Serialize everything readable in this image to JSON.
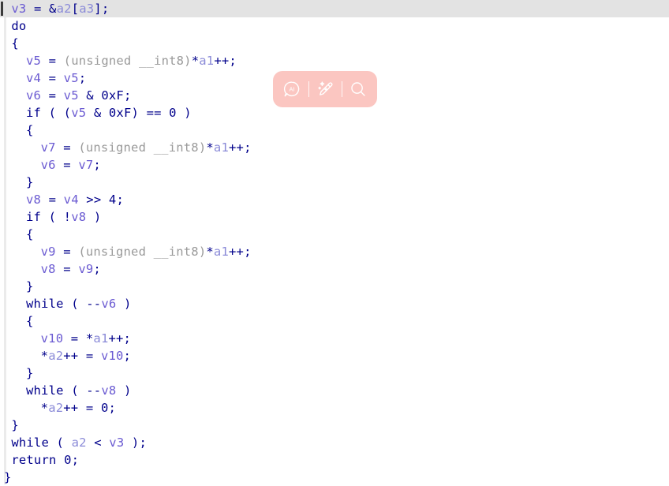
{
  "editor": {
    "language": "c-pseudocode",
    "current_line_index": 0,
    "colors": {
      "background": "#ffffff",
      "current_line_highlight": "#e3e3e3",
      "caret": "#3a3a3a",
      "gutter_rule": "#ebebeb",
      "keyword": "#00008b",
      "punctuation": "#00008b",
      "number": "#00008b",
      "local_variable": "#6b5bd2",
      "argument": "#8b8bd8",
      "type_cast": "#9a9a9a"
    },
    "lines": [
      {
        "indent": 1,
        "current": true,
        "tokens": [
          {
            "t": "v3",
            "c": "local"
          },
          {
            "t": " ",
            "c": "punc"
          },
          {
            "t": "=",
            "c": "punc"
          },
          {
            "t": " ",
            "c": "punc"
          },
          {
            "t": "&",
            "c": "punc"
          },
          {
            "t": "a2",
            "c": "arg"
          },
          {
            "t": "[",
            "c": "punc"
          },
          {
            "t": "a3",
            "c": "arg"
          },
          {
            "t": "]",
            "c": "punc"
          },
          {
            "t": ";",
            "c": "punc"
          }
        ]
      },
      {
        "indent": 1,
        "current": false,
        "tokens": [
          {
            "t": "do",
            "c": "kw"
          }
        ]
      },
      {
        "indent": 1,
        "current": false,
        "tokens": [
          {
            "t": "{",
            "c": "punc"
          }
        ]
      },
      {
        "indent": 3,
        "current": false,
        "tokens": [
          {
            "t": "v5",
            "c": "local"
          },
          {
            "t": " = ",
            "c": "punc"
          },
          {
            "t": "(unsigned __int8)",
            "c": "type"
          },
          {
            "t": "*",
            "c": "punc"
          },
          {
            "t": "a1",
            "c": "arg"
          },
          {
            "t": "++;",
            "c": "punc"
          }
        ]
      },
      {
        "indent": 3,
        "current": false,
        "tokens": [
          {
            "t": "v4",
            "c": "local"
          },
          {
            "t": " = ",
            "c": "punc"
          },
          {
            "t": "v5",
            "c": "local"
          },
          {
            "t": ";",
            "c": "punc"
          }
        ]
      },
      {
        "indent": 3,
        "current": false,
        "tokens": [
          {
            "t": "v6",
            "c": "local"
          },
          {
            "t": " = ",
            "c": "punc"
          },
          {
            "t": "v5",
            "c": "local"
          },
          {
            "t": " & ",
            "c": "punc"
          },
          {
            "t": "0xF",
            "c": "num"
          },
          {
            "t": ";",
            "c": "punc"
          }
        ]
      },
      {
        "indent": 3,
        "current": false,
        "tokens": [
          {
            "t": "if",
            "c": "kw"
          },
          {
            "t": " ( (",
            "c": "punc"
          },
          {
            "t": "v5",
            "c": "local"
          },
          {
            "t": " & ",
            "c": "punc"
          },
          {
            "t": "0xF",
            "c": "num"
          },
          {
            "t": ") == ",
            "c": "punc"
          },
          {
            "t": "0",
            "c": "num"
          },
          {
            "t": " )",
            "c": "punc"
          }
        ]
      },
      {
        "indent": 3,
        "current": false,
        "tokens": [
          {
            "t": "{",
            "c": "punc"
          }
        ]
      },
      {
        "indent": 5,
        "current": false,
        "tokens": [
          {
            "t": "v7",
            "c": "local"
          },
          {
            "t": " = ",
            "c": "punc"
          },
          {
            "t": "(unsigned __int8)",
            "c": "type"
          },
          {
            "t": "*",
            "c": "punc"
          },
          {
            "t": "a1",
            "c": "arg"
          },
          {
            "t": "++;",
            "c": "punc"
          }
        ]
      },
      {
        "indent": 5,
        "current": false,
        "tokens": [
          {
            "t": "v6",
            "c": "local"
          },
          {
            "t": " = ",
            "c": "punc"
          },
          {
            "t": "v7",
            "c": "local"
          },
          {
            "t": ";",
            "c": "punc"
          }
        ]
      },
      {
        "indent": 3,
        "current": false,
        "tokens": [
          {
            "t": "}",
            "c": "punc"
          }
        ]
      },
      {
        "indent": 3,
        "current": false,
        "tokens": [
          {
            "t": "v8",
            "c": "local"
          },
          {
            "t": " = ",
            "c": "punc"
          },
          {
            "t": "v4",
            "c": "local"
          },
          {
            "t": " >> ",
            "c": "punc"
          },
          {
            "t": "4",
            "c": "num"
          },
          {
            "t": ";",
            "c": "punc"
          }
        ]
      },
      {
        "indent": 3,
        "current": false,
        "tokens": [
          {
            "t": "if",
            "c": "kw"
          },
          {
            "t": " ( !",
            "c": "punc"
          },
          {
            "t": "v8",
            "c": "local"
          },
          {
            "t": " )",
            "c": "punc"
          }
        ]
      },
      {
        "indent": 3,
        "current": false,
        "tokens": [
          {
            "t": "{",
            "c": "punc"
          }
        ]
      },
      {
        "indent": 5,
        "current": false,
        "tokens": [
          {
            "t": "v9",
            "c": "local"
          },
          {
            "t": " = ",
            "c": "punc"
          },
          {
            "t": "(unsigned __int8)",
            "c": "type"
          },
          {
            "t": "*",
            "c": "punc"
          },
          {
            "t": "a1",
            "c": "arg"
          },
          {
            "t": "++;",
            "c": "punc"
          }
        ]
      },
      {
        "indent": 5,
        "current": false,
        "tokens": [
          {
            "t": "v8",
            "c": "local"
          },
          {
            "t": " = ",
            "c": "punc"
          },
          {
            "t": "v9",
            "c": "local"
          },
          {
            "t": ";",
            "c": "punc"
          }
        ]
      },
      {
        "indent": 3,
        "current": false,
        "tokens": [
          {
            "t": "}",
            "c": "punc"
          }
        ]
      },
      {
        "indent": 3,
        "current": false,
        "tokens": [
          {
            "t": "while",
            "c": "kw"
          },
          {
            "t": " ( --",
            "c": "punc"
          },
          {
            "t": "v6",
            "c": "local"
          },
          {
            "t": " )",
            "c": "punc"
          }
        ]
      },
      {
        "indent": 3,
        "current": false,
        "tokens": [
          {
            "t": "{",
            "c": "punc"
          }
        ]
      },
      {
        "indent": 5,
        "current": false,
        "tokens": [
          {
            "t": "v10",
            "c": "local"
          },
          {
            "t": " = ",
            "c": "punc"
          },
          {
            "t": "*",
            "c": "punc"
          },
          {
            "t": "a1",
            "c": "arg"
          },
          {
            "t": "++;",
            "c": "punc"
          }
        ]
      },
      {
        "indent": 5,
        "current": false,
        "tokens": [
          {
            "t": "*",
            "c": "punc"
          },
          {
            "t": "a2",
            "c": "arg"
          },
          {
            "t": "++ = ",
            "c": "punc"
          },
          {
            "t": "v10",
            "c": "local"
          },
          {
            "t": ";",
            "c": "punc"
          }
        ]
      },
      {
        "indent": 3,
        "current": false,
        "tokens": [
          {
            "t": "}",
            "c": "punc"
          }
        ]
      },
      {
        "indent": 3,
        "current": false,
        "tokens": [
          {
            "t": "while",
            "c": "kw"
          },
          {
            "t": " ( --",
            "c": "punc"
          },
          {
            "t": "v8",
            "c": "local"
          },
          {
            "t": " )",
            "c": "punc"
          }
        ]
      },
      {
        "indent": 5,
        "current": false,
        "tokens": [
          {
            "t": "*",
            "c": "punc"
          },
          {
            "t": "a2",
            "c": "arg"
          },
          {
            "t": "++ = ",
            "c": "punc"
          },
          {
            "t": "0",
            "c": "num"
          },
          {
            "t": ";",
            "c": "punc"
          }
        ]
      },
      {
        "indent": 1,
        "current": false,
        "tokens": [
          {
            "t": "}",
            "c": "punc"
          }
        ]
      },
      {
        "indent": 1,
        "current": false,
        "tokens": [
          {
            "t": "while",
            "c": "kw"
          },
          {
            "t": " ( ",
            "c": "punc"
          },
          {
            "t": "a2",
            "c": "arg"
          },
          {
            "t": " < ",
            "c": "punc"
          },
          {
            "t": "v3",
            "c": "local"
          },
          {
            "t": " );",
            "c": "punc"
          }
        ]
      },
      {
        "indent": 1,
        "current": false,
        "tokens": [
          {
            "t": "return",
            "c": "kw"
          },
          {
            "t": " ",
            "c": "punc"
          },
          {
            "t": "0",
            "c": "num"
          },
          {
            "t": ";",
            "c": "punc"
          }
        ]
      },
      {
        "indent": 0,
        "current": false,
        "tokens": [
          {
            "t": "}",
            "c": "punc"
          }
        ]
      }
    ]
  },
  "ai_toolbar": {
    "background_color": "#fbc6c1",
    "icon_color": "#ffffff",
    "buttons": [
      {
        "name": "ai-assistant-icon",
        "label": "AI"
      },
      {
        "name": "magic-pen-icon",
        "label": ""
      },
      {
        "name": "search-icon",
        "label": ""
      }
    ]
  }
}
